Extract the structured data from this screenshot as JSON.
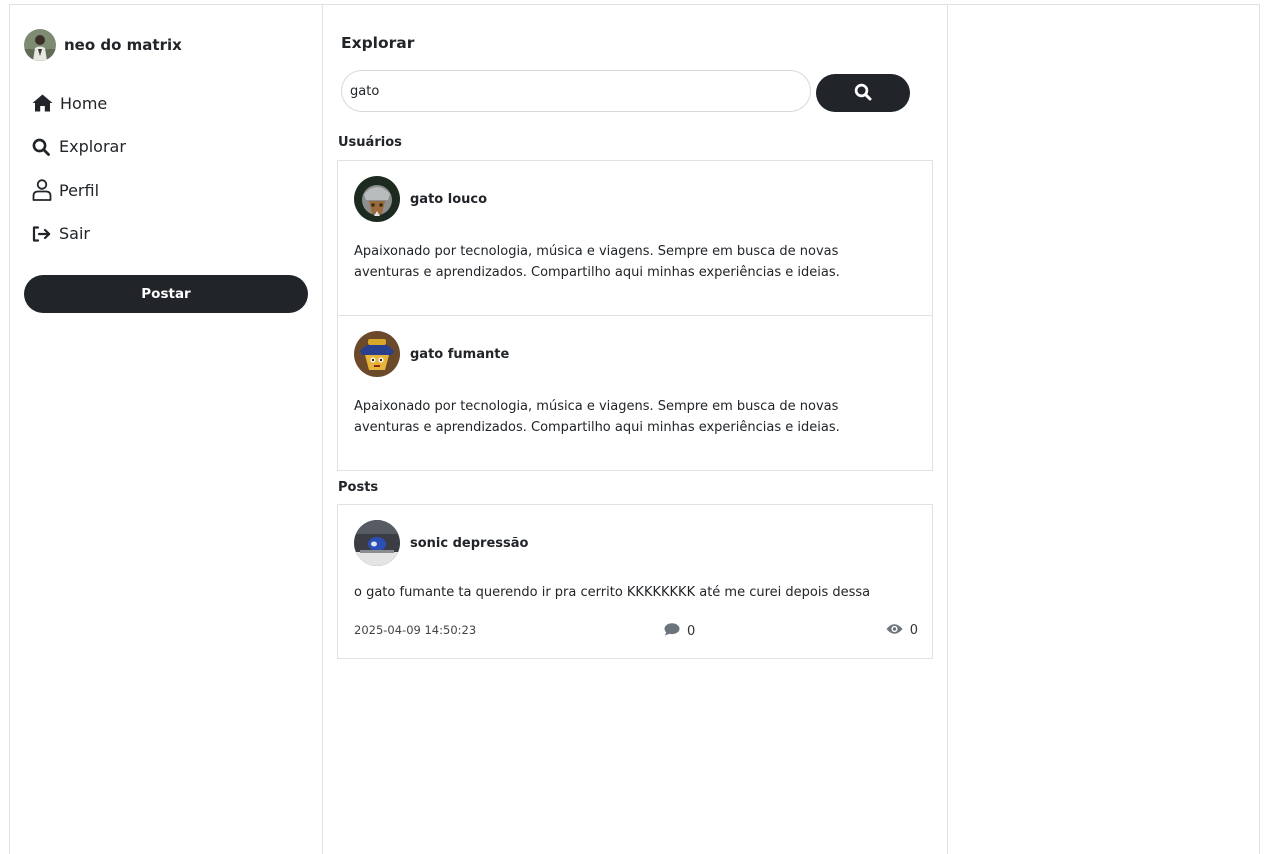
{
  "sidebar": {
    "user_name": "neo do matrix",
    "nav": [
      {
        "label": "Home",
        "icon": "home-icon"
      },
      {
        "label": "Explorar",
        "icon": "search-icon"
      },
      {
        "label": "Perfil",
        "icon": "user-icon"
      },
      {
        "label": "Sair",
        "icon": "logout-icon"
      }
    ],
    "post_button": "Postar"
  },
  "explore": {
    "title": "Explorar",
    "search_value": "gato",
    "users_label": "Usuários",
    "posts_label": "Posts",
    "users": [
      {
        "name": "gato louco",
        "bio": "Apaixonado por tecnologia, música e viagens. Sempre em busca de novas aventuras e aprendizados. Compartilho aqui minhas experiências e ideias."
      },
      {
        "name": "gato fumante",
        "bio": "Apaixonado por tecnologia, música e viagens. Sempre em busca de novas aventuras e aprendizados. Compartilho aqui minhas experiências e ideias."
      }
    ],
    "posts": [
      {
        "author": "sonic depressão",
        "text": "o gato fumante ta querendo ir pra cerrito KKKKKKKK até me curei depois dessa",
        "date": "2025-04-09 14:50:23",
        "comments": "0",
        "views": "0"
      }
    ]
  },
  "colors": {
    "primary_dark": "#212529",
    "border": "#dfe1e4",
    "icon_gray": "#6c757d"
  }
}
